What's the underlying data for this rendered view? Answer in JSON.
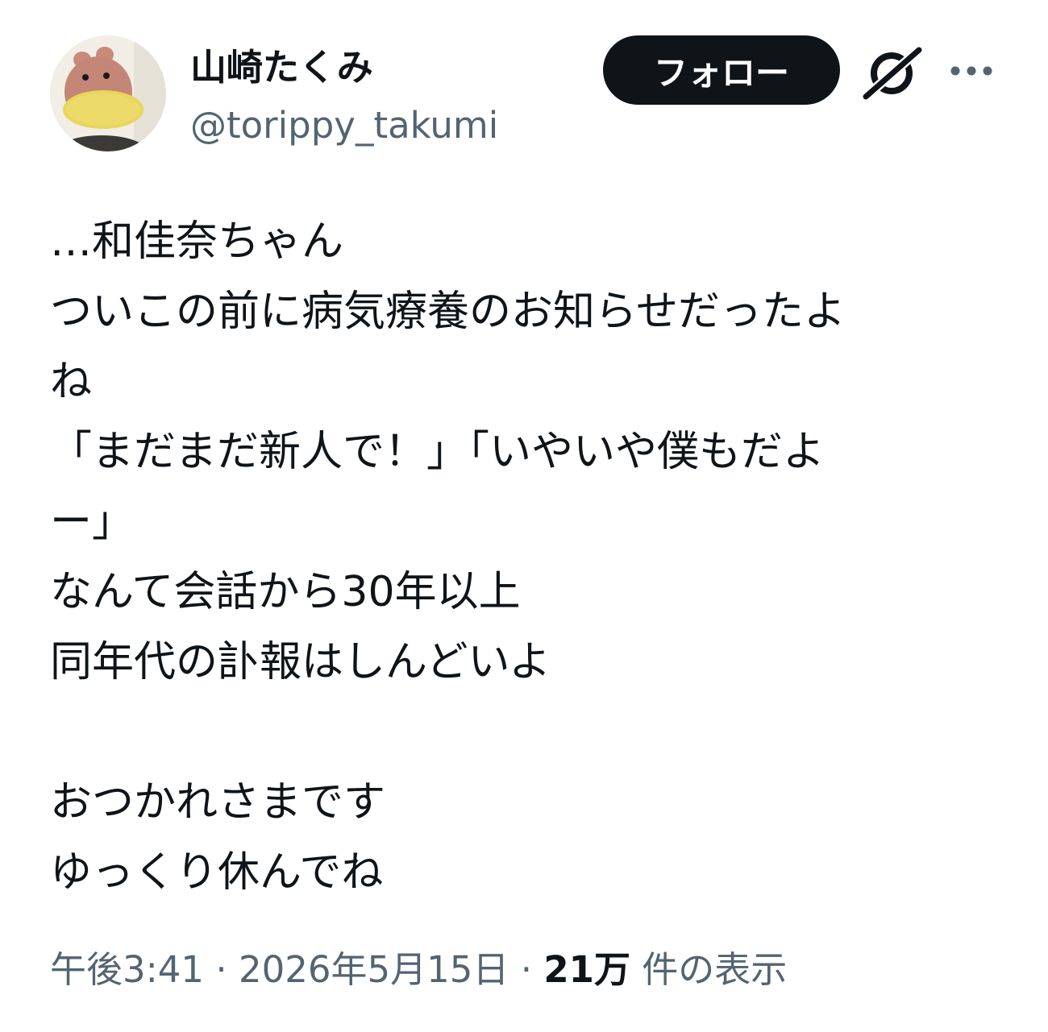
{
  "author": {
    "display_name": "山崎たくみ",
    "handle": "@torippy_takumi",
    "avatar_icon": "plush-toy-avatar"
  },
  "actions": {
    "follow_label": "フォロー",
    "grok_icon": "grok-slash-icon",
    "more_icon": "more-horizontal-icon"
  },
  "tweet": {
    "lines": [
      "…和佳奈ちゃん",
      "ついこの前に病気療養のお知らせだったよ",
      "ね",
      "「まだまだ新人で！」「いやいや僕もだよ",
      "ー」",
      "なんて会話から30年以上",
      "同年代の訃報はしんどいよ",
      "",
      "おつかれさまです",
      "ゆっくり休んでね"
    ]
  },
  "meta": {
    "time": "午後3:41",
    "separator": " · ",
    "date": "2026年5月15日",
    "views_count": "21万",
    "views_label": " 件の表示"
  },
  "colors": {
    "text": "#0f1419",
    "secondary": "#536471",
    "button_bg": "#0f1419",
    "button_text": "#ffffff"
  }
}
